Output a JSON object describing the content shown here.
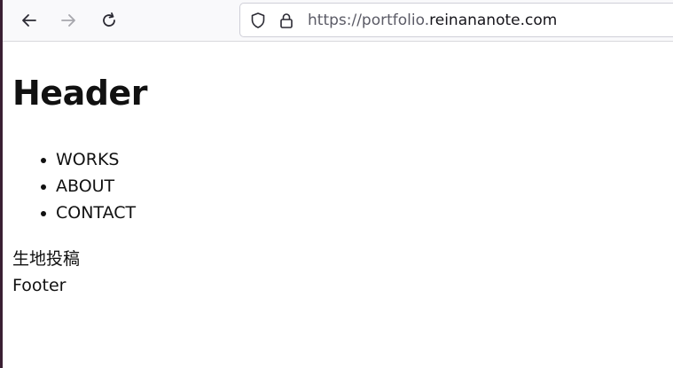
{
  "browser": {
    "url_prefix": "https://portfolio.",
    "url_domain": "reinananote.com",
    "icons": {
      "back": "back-arrow-icon",
      "forward": "forward-arrow-icon",
      "reload": "reload-icon",
      "tracking_protection": "shield-icon",
      "security": "lock-icon"
    }
  },
  "page": {
    "header": "Header",
    "nav_items": [
      "WORKS",
      "ABOUT",
      "CONTACT"
    ],
    "main_text": "生地投稿",
    "footer": "Footer"
  }
}
